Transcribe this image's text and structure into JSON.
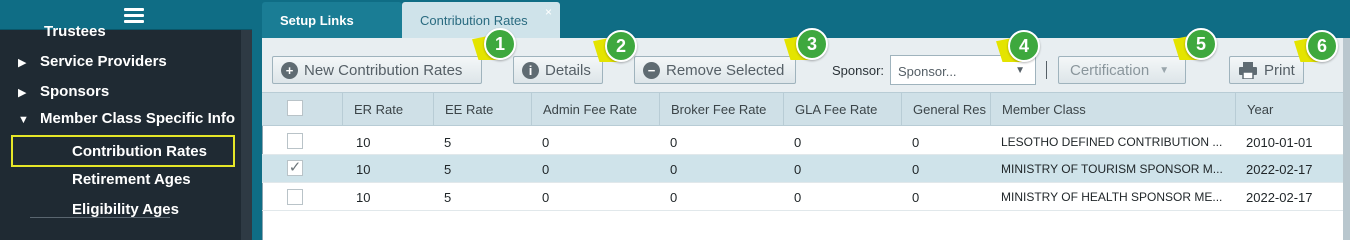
{
  "sidebar": {
    "menu_icon": "hamburger-menu-icon",
    "items": [
      {
        "label": "Trustees"
      },
      {
        "label": "Service Providers",
        "icon": "triangle-right-icon"
      },
      {
        "label": "Sponsors",
        "icon": "triangle-right-icon"
      },
      {
        "label": "Member Class Specific Info",
        "icon": "triangle-down-icon"
      }
    ],
    "subitems": [
      {
        "label": "Contribution Rates",
        "active": true
      },
      {
        "label": "Retirement Ages"
      },
      {
        "label": "Eligibility Ages"
      }
    ]
  },
  "tabs": [
    {
      "label": "Setup Links"
    },
    {
      "label": "Contribution Rates",
      "active": true,
      "close": "×"
    }
  ],
  "toolbar": {
    "new_label": "New Contribution Rates",
    "details_label": "Details",
    "remove_label": "Remove Selected",
    "sponsor_label": "Sponsor:",
    "sponsor_placeholder": "Sponsor...",
    "certification_label": "Certification",
    "print_label": "Print"
  },
  "callouts": [
    "1",
    "2",
    "3",
    "4",
    "5",
    "6"
  ],
  "table": {
    "columns": [
      "ER Rate",
      "EE Rate",
      "Admin Fee Rate",
      "Broker Fee Rate",
      "GLA Fee Rate",
      "General Res",
      "Member Class",
      "Year"
    ],
    "rows": [
      {
        "checked": false,
        "cells": [
          "10",
          "5",
          "0",
          "0",
          "0",
          "0",
          "LESOTHO DEFINED CONTRIBUTION ...",
          "2010-01-01"
        ]
      },
      {
        "checked": true,
        "cells": [
          "10",
          "5",
          "0",
          "0",
          "0",
          "0",
          "MINISTRY OF TOURISM SPONSOR M...",
          "2022-02-17"
        ]
      },
      {
        "checked": false,
        "cells": [
          "10",
          "5",
          "0",
          "0",
          "0",
          "0",
          "MINISTRY OF HEALTH SPONSOR ME...",
          "2022-02-17"
        ]
      }
    ]
  },
  "colors": {
    "sidebar_bg": "#1f2a33",
    "teal": "#0f6d85",
    "highlight_box": "#e6e628",
    "callout_green": "#3ea83e",
    "callout_yellow": "#e4e400",
    "selected_row": "#cfe3ea"
  }
}
